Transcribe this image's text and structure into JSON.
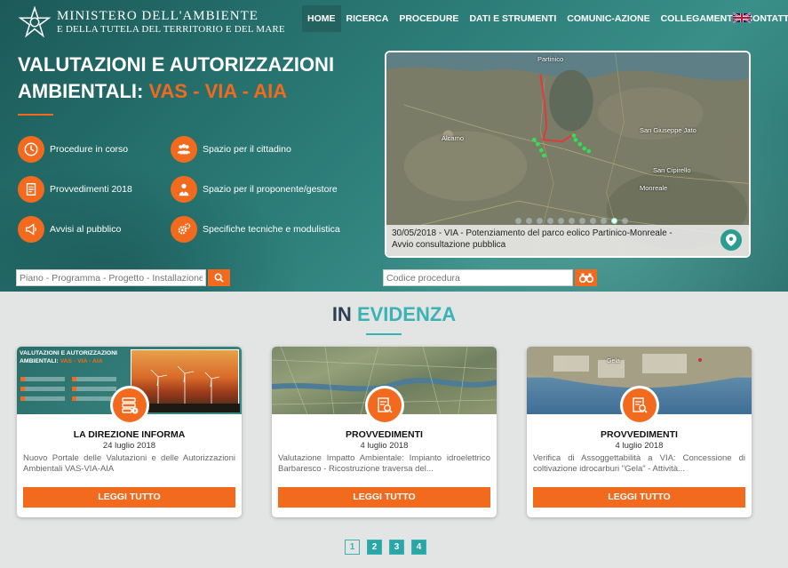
{
  "header": {
    "logo_line1": "MINISTERO DELL'AMBIENTE",
    "logo_line2": "E DELLA TUTELA DEL TERRITORIO E DEL MARE",
    "nav": [
      "HOME",
      "RICERCA",
      "PROCEDURE",
      "DATI E STRUMENTI",
      "COMUNIC-AZIONE",
      "COLLEGAMENTI",
      "CONTATTI"
    ],
    "language_flag": "uk-flag-icon"
  },
  "hero": {
    "title_line1": "VALUTAZIONI E AUTORIZZAZIONI",
    "title_line2_prefix": "AMBIENTALI: ",
    "title_line2_highlight": "VAS - VIA - AIA",
    "quick_links": [
      {
        "label": "Procedure in corso",
        "icon": "clock-icon"
      },
      {
        "label": "Spazio per il cittadino",
        "icon": "people-icon"
      },
      {
        "label": "Provvedimenti 2018",
        "icon": "document-icon"
      },
      {
        "label": "Spazio per il proponente/gestore",
        "icon": "person-tie-icon"
      },
      {
        "label": "Avvisi al pubblico",
        "icon": "megaphone-icon"
      },
      {
        "label": "Specifiche tecniche e modulistica",
        "icon": "gears-icon"
      }
    ]
  },
  "map": {
    "labels": [
      "Partinico",
      "Alcamo",
      "San Giuseppe Jato",
      "San Cipirello",
      "Monreale"
    ],
    "caption_line1": "30/05/2018 - VIA - Potenziamento del parco eolico Partinico-Monreale -",
    "caption_line2": "Avvio consultazione pubblica",
    "slides": 10,
    "active_slide": 9
  },
  "search": {
    "left_placeholder": "Piano - Programma - Progetto - Installazione",
    "right_placeholder": "Codice procedura"
  },
  "evidenza": {
    "title_part1": "IN ",
    "title_part2": "EVIDENZA",
    "thumb_title_line1": "VALUTAZIONI E AUTORIZZAZIONI",
    "thumb_title_line2": "AMBIENTALI: ",
    "thumb_title_highlight": "VAS - VIA - AIA",
    "cards": [
      {
        "category": "LA DIREZIONE INFORMA",
        "date": "24 luglio 2018",
        "text": "Nuovo Portale delle Valutazioni e delle Autorizzazioni Ambientali VAS-VIA-AIA",
        "button": "LEGGI TUTTO"
      },
      {
        "category": "PROVVEDIMENTI",
        "date": "4 luglio 2018",
        "text": "Valutazione Impatto Ambientale: Impianto idroelettrico Barbaresco - Ricostruzione traversa del...",
        "button": "LEGGI TUTTO"
      },
      {
        "category": "PROVVEDIMENTI",
        "date": "4 luglio 2018",
        "text": "Verifica di Assoggettabilità a VIA: Concessione di coltivazione idrocarburi \"Gela\" - Attività...",
        "button": "LEGGI TUTTO",
        "image_label": "Gela"
      }
    ],
    "pages": [
      "1",
      "2",
      "3",
      "4"
    ],
    "current_page": "1"
  },
  "colors": {
    "accent": "#f26a1d",
    "teal": "#3bb3b4",
    "hero": "#2c7d79"
  }
}
